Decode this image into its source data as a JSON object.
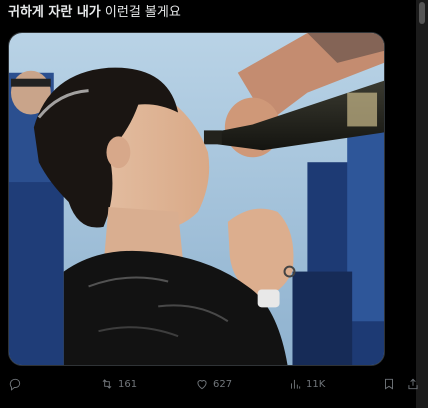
{
  "post": {
    "text_bold": "귀하게 자란 내가",
    "text_rest": " 이런걸 볼게요"
  },
  "media": {
    "description_icon": "photo"
  },
  "actions": {
    "reply": {
      "icon": "reply-icon",
      "count": ""
    },
    "retweet": {
      "icon": "retweet-icon",
      "count": "161"
    },
    "like": {
      "icon": "heart-icon",
      "count": "627"
    },
    "views": {
      "icon": "views-icon",
      "count": "11K"
    },
    "bookmark": {
      "icon": "bookmark-icon"
    },
    "share": {
      "icon": "share-icon"
    }
  },
  "colors": {
    "background": "#000000",
    "text": "#e7e9ea",
    "muted": "#71767b"
  }
}
